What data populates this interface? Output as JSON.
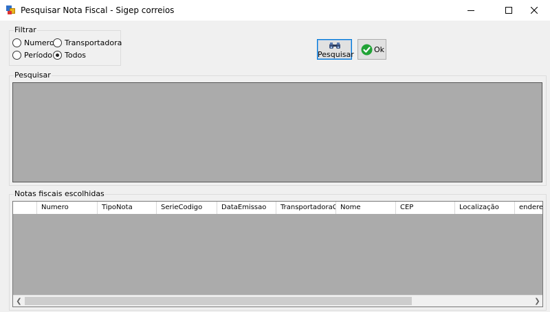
{
  "window": {
    "title": "Pesquisar Nota Fiscal - Sigep correios"
  },
  "filter": {
    "legend": "Filtrar",
    "options": [
      {
        "label": "Numero",
        "checked": false
      },
      {
        "label": "Transportadora",
        "checked": false
      },
      {
        "label": "Período",
        "checked": false
      },
      {
        "label": "Todos",
        "checked": true
      }
    ]
  },
  "buttons": {
    "search_label": "Pesquisar",
    "ok_label": "Ok"
  },
  "search_group": {
    "legend": "Pesquisar"
  },
  "chosen_group": {
    "legend": "Notas fiscais escolhidas",
    "columns": [
      "Numero",
      "TipoNota",
      "SerieCodigo",
      "DataEmissao",
      "TransportadoraCod",
      "Nome",
      "CEP",
      "Localização",
      "endereco"
    ]
  },
  "colors": {
    "grid_background": "#ababab",
    "window_background": "#f0f0f0",
    "focus_border": "#0078d7",
    "ok_check": "#21a336"
  }
}
